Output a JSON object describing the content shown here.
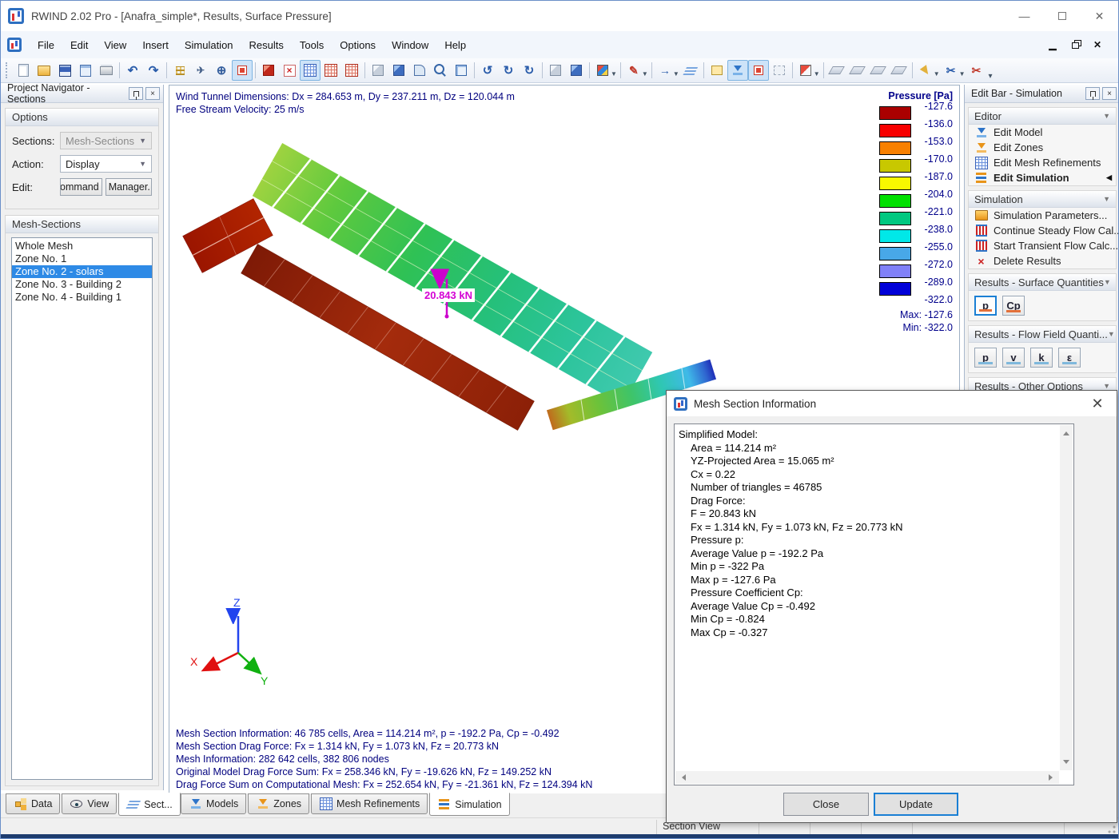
{
  "titlebar": {
    "title": "RWIND 2.02 Pro - [Anafra_simple*, Results, Surface Pressure]"
  },
  "menubar": {
    "items": [
      "File",
      "Edit",
      "View",
      "Insert",
      "Simulation",
      "Results",
      "Tools",
      "Options",
      "Window",
      "Help"
    ]
  },
  "toolbar": {
    "buttons": [
      {
        "name": "new-file",
        "icon": "page"
      },
      {
        "name": "open-file",
        "icon": "folder"
      },
      {
        "name": "save",
        "icon": "disk"
      },
      {
        "name": "print-preview",
        "icon": "page-b"
      },
      {
        "name": "print",
        "icon": "printer"
      },
      {
        "sep": true
      },
      {
        "name": "undo",
        "icon": "undo",
        "glyph": "↶"
      },
      {
        "name": "redo",
        "icon": "redo",
        "glyph": "↷"
      },
      {
        "sep": true
      },
      {
        "name": "snap-points",
        "icon": "dots"
      },
      {
        "name": "navigation-mode",
        "icon": "fly",
        "glyph": "✈"
      },
      {
        "name": "crosshair",
        "icon": "target",
        "glyph": "⊕"
      },
      {
        "name": "center-marker",
        "icon": "dot-red",
        "toggled": true
      },
      {
        "sep": true
      },
      {
        "name": "start-analysis",
        "icon": "cube-red"
      },
      {
        "name": "stop-analysis",
        "icon": "xbox",
        "glyph": "×"
      },
      {
        "name": "show-mesh",
        "icon": "mesh-b",
        "toggled": true
      },
      {
        "name": "mesh-quality",
        "icon": "mesh-r"
      },
      {
        "name": "mesh-cut",
        "icon": "mesh-r"
      },
      {
        "sep": true
      },
      {
        "name": "wireframe-view",
        "icon": "cube-gray"
      },
      {
        "name": "shaded-view",
        "icon": "cube-blue"
      },
      {
        "name": "corner-view",
        "icon": "corner"
      },
      {
        "name": "zoom-window",
        "icon": "zoom"
      },
      {
        "name": "zoom-fit",
        "icon": "zoomfit"
      },
      {
        "sep": true
      },
      {
        "name": "rotate-view",
        "icon": "rot1",
        "glyph": "↺"
      },
      {
        "name": "rotate-view-2",
        "icon": "rot2",
        "glyph": "↻"
      },
      {
        "name": "rotate-view-3",
        "icon": "rot2",
        "glyph": "↻"
      },
      {
        "sep": true
      },
      {
        "name": "isometric-view",
        "icon": "cube-gray"
      },
      {
        "name": "projection-mode",
        "icon": "cube-blue"
      },
      {
        "sep": true
      },
      {
        "name": "view-direction",
        "icon": "cube-multi",
        "dd": true
      },
      {
        "sep": true
      },
      {
        "name": "display-colors",
        "icon": "pens",
        "glyph": "✎",
        "dd": true
      },
      {
        "sep": true
      },
      {
        "name": "flow-display",
        "icon": "arrow-b",
        "glyph": "→",
        "dd": true
      },
      {
        "name": "layers-display",
        "icon": "layers"
      },
      {
        "sep": true
      },
      {
        "name": "clipping-box",
        "icon": "box-y"
      },
      {
        "name": "section-plane-1",
        "icon": "plumb-b",
        "toggled": true
      },
      {
        "name": "section-plane-2",
        "icon": "dot-red",
        "toggled": true
      },
      {
        "name": "ghost-mode",
        "icon": "ghost"
      },
      {
        "sep": true
      },
      {
        "name": "half-model",
        "icon": "half",
        "dd": true
      },
      {
        "sep": true
      },
      {
        "name": "plane-xy",
        "icon": "plane"
      },
      {
        "name": "plane-xz",
        "icon": "plane"
      },
      {
        "name": "plane-yz",
        "icon": "plane"
      },
      {
        "name": "plane-flip",
        "icon": "plane"
      },
      {
        "sep": true
      },
      {
        "name": "select-tool",
        "icon": "cursor-y",
        "dd": true
      },
      {
        "name": "clip-scissors",
        "icon": "scissors-b",
        "glyph": "✂",
        "dd": true
      },
      {
        "name": "delete-section",
        "icon": "scissors-r",
        "glyph": "✂"
      }
    ]
  },
  "left_panel": {
    "title": "Project Navigator - Sections",
    "options": {
      "header": "Options",
      "sections_label": "Sections:",
      "sections_value": "Mesh-Sections",
      "action_label": "Action:",
      "action_value": "Display",
      "edit_label": "Edit:",
      "edit_buttons": [
        "Command",
        "Manager..."
      ]
    },
    "mesh_sections": {
      "header": "Mesh-Sections",
      "items": [
        "Whole Mesh",
        "Zone No. 1",
        "Zone No. 2 - solars",
        "Zone No. 3 - Building 2",
        "Zone No. 4 - Building 1"
      ],
      "selected_index": 2
    }
  },
  "viewport": {
    "info_top": [
      "Wind Tunnel Dimensions: Dx = 284.653 m, Dy = 237.211 m, Dz = 120.044 m",
      "Free Stream Velocity: 25 m/s"
    ],
    "info_bottom": [
      "Mesh Section Information: 46 785 cells, Area = 114.214 m², p = -192.2 Pa, Cp = -0.492",
      "Mesh Section Drag Force: Fx = 1.314 kN, Fy = 1.073 kN, Fz = 20.773 kN",
      "Mesh Information: 282 642 cells, 382 806 nodes",
      "Original Model Drag Force Sum: Fx = 258.346 kN, Fy = -19.626 kN, Fz = 149.252 kN",
      "Drag Force Sum on Computational Mesh: Fx = 252.654 kN, Fy = -21.361 kN, Fz = 124.394 kN"
    ],
    "force_label": "20.843 kN",
    "force_color": "#d400d4",
    "axes": {
      "x": "X",
      "y": "Y",
      "z": "Z",
      "x_color": "#e01010",
      "y_color": "#10b010",
      "z_color": "#2244ee"
    },
    "legend": {
      "title": "Pressure [Pa]",
      "colors": [
        "#aa0000",
        "#f80000",
        "#f88000",
        "#c8c800",
        "#f8f800",
        "#00e000",
        "#00c880",
        "#00e8e8",
        "#48a8e8",
        "#8080f8",
        "#0000d8"
      ],
      "values": [
        "-127.6",
        "-136.0",
        "-153.0",
        "-170.0",
        "-187.0",
        "-204.0",
        "-221.0",
        "-238.0",
        "-255.0",
        "-272.0",
        "-289.0",
        "-322.0"
      ],
      "max_label": "Max:",
      "max_value": "-127.6",
      "min_label": "Min:",
      "min_value": "-322.0"
    }
  },
  "right_panel": {
    "title": "Edit Bar - Simulation",
    "sections": [
      {
        "header": "Editor",
        "items": [
          {
            "label": "Edit Model",
            "icon": "plumb-b"
          },
          {
            "label": "Edit Zones",
            "icon": "plumb-o"
          },
          {
            "label": "Edit Mesh Refinements",
            "icon": "mesh-b"
          },
          {
            "label": "Edit Simulation",
            "icon": "bars",
            "bold": true,
            "marker": "◀"
          }
        ]
      },
      {
        "header": "Simulation",
        "items": [
          {
            "label": "Simulation Parameters...",
            "icon": "folder-gear"
          },
          {
            "label": "Continue Steady Flow Cal...",
            "icon": "abacus"
          },
          {
            "label": "Start Transient Flow Calc...",
            "icon": "abacus"
          },
          {
            "label": "Delete Results",
            "icon": "del",
            "glyph": "×"
          }
        ]
      },
      {
        "header": "Results - Surface Quantities",
        "buttons": [
          {
            "label": "p",
            "active": true,
            "underline": "#e2703a"
          },
          {
            "label": "Cp",
            "underline": "#e2703a"
          }
        ]
      },
      {
        "header": "Results - Flow Field Quanti...",
        "buttons": [
          {
            "label": "p",
            "underline": "#7fb8dc"
          },
          {
            "label": "v",
            "underline": "#7fb8dc"
          },
          {
            "label": "k",
            "underline": "#7fb8dc"
          },
          {
            "label": "ε",
            "underline": "#7fb8dc"
          }
        ]
      },
      {
        "header": "Results - Other Options",
        "iconbuttons": [
          {
            "name": "flow-arrows",
            "icon": "flow",
            "glyph": "⇉"
          },
          {
            "name": "streamlines",
            "icon": "waves",
            "glyph": "≈"
          },
          {
            "name": "result-diagram",
            "icon": "chart"
          },
          {
            "name": "result-grid",
            "icon": "grid-diag"
          },
          {
            "name": "section-info",
            "icon": "info-sc",
            "glyph": "✂"
          }
        ]
      }
    ]
  },
  "dialog": {
    "title": "Mesh Section Information",
    "lines": [
      "Simplified Model:",
      "Area = 114.214 m²",
      "YZ-Projected Area = 15.065 m²",
      "Cx = 0.22",
      "Number of triangles = 46785",
      "Drag Force:",
      "F = 20.843 kN",
      "Fx = 1.314 kN, Fy = 1.073 kN, Fz = 20.773 kN",
      "Pressure p:",
      "Average Value p = -192.2 Pa",
      "Min p = -322 Pa",
      "Max p = -127.6 Pa",
      "Pressure Coefficient Cp:",
      "Average Value Cp = -0.492",
      "Min Cp = -0.824",
      "Max Cp = -0.327"
    ],
    "buttons": {
      "close": "Close",
      "update": "Update"
    }
  },
  "tabs": {
    "left": [
      {
        "label": "Data",
        "icon": "tree"
      },
      {
        "label": "View",
        "icon": "eye"
      },
      {
        "label": "Sect...",
        "icon": "layers",
        "active": true
      }
    ],
    "main": [
      {
        "label": "Models",
        "icon": "plumb-b"
      },
      {
        "label": "Zones",
        "icon": "plumb-o"
      },
      {
        "label": "Mesh Refinements",
        "icon": "mesh-b"
      },
      {
        "label": "Simulation",
        "icon": "bars",
        "active": true
      }
    ]
  },
  "statusbar": {
    "text": "Section View"
  }
}
